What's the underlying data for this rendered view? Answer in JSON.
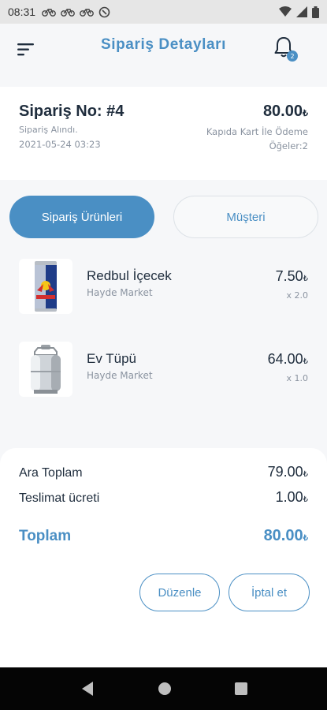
{
  "status_bar": {
    "time": "08:31",
    "left_icons": [
      "bicycle-icon",
      "bicycle-icon",
      "bicycle-icon",
      "vpn-icon"
    ],
    "right_icons": [
      "wifi-icon",
      "signal-icon",
      "battery-icon"
    ]
  },
  "header": {
    "title": "Sipariş Detayları",
    "notification_count": "2"
  },
  "order": {
    "number": "Sipariş No: #4",
    "status": "Sipariş Alındı.",
    "date": "2021-05-24 03:23",
    "total": "80.00",
    "currency": "₺",
    "payment_method": "Kapıda Kart İle Ödeme",
    "items_count": "Öğeler:2"
  },
  "tabs": [
    {
      "label": "Sipariş Ürünleri",
      "active": true
    },
    {
      "label": "Müşteri",
      "active": false
    }
  ],
  "products": [
    {
      "name": "Redbul İçecek",
      "store": "Hayde Market",
      "price": "7.50",
      "currency": "₺",
      "qty": "x 2.0",
      "image": "energy-drink-can"
    },
    {
      "name": "Ev Tüpü",
      "store": "Hayde Market",
      "price": "64.00",
      "currency": "₺",
      "qty": "x 1.0",
      "image": "gas-cylinder"
    }
  ],
  "summary": {
    "subtotal_label": "Ara Toplam",
    "subtotal_value": "79.00",
    "delivery_label": "Teslimat ücreti",
    "delivery_value": "1.00",
    "total_label": "Toplam",
    "total_value": "80.00",
    "currency": "₺"
  },
  "actions": {
    "edit_label": "Düzenle",
    "cancel_label": "İptal et"
  },
  "colors": {
    "accent": "#4a8fc4",
    "text_dark": "#1f2d3d",
    "text_muted": "#8a93a0",
    "background": "#f6f7f9"
  }
}
